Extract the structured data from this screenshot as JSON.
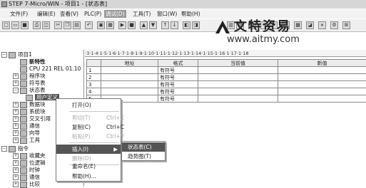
{
  "window": {
    "title": "STEP 7-Micro/WIN - 项目1 - [状态表]"
  },
  "menubar": {
    "items": [
      {
        "label": "文件(F)"
      },
      {
        "label": "编辑(E)"
      },
      {
        "label": "查看(V)"
      },
      {
        "label": "PLC(P)"
      },
      {
        "label": "调试(D)"
      },
      {
        "label": "工具(T)"
      },
      {
        "label": "窗口(W)"
      },
      {
        "label": "帮助(H)"
      }
    ]
  },
  "watermark": {
    "logo_text": "文特资易",
    "url": "www.aitmy.com"
  },
  "tree": {
    "items": [
      {
        "label": "项目1",
        "icon": "project-icon",
        "exp": "-"
      },
      {
        "label": "新特性",
        "icon": "question-icon",
        "exp": ""
      },
      {
        "label": "CPU 221 REL 01.10",
        "icon": "cpu-icon",
        "exp": ""
      },
      {
        "label": "程序块",
        "icon": "folder-icon",
        "exp": "+"
      },
      {
        "label": "符号表",
        "icon": "folder-icon",
        "exp": "+"
      },
      {
        "label": "状态表",
        "icon": "folder-icon",
        "exp": "-"
      },
      {
        "label": "用户定义",
        "icon": "table-icon",
        "exp": ""
      },
      {
        "label": "数据块",
        "icon": "folder-icon",
        "exp": "+"
      },
      {
        "label": "系统块",
        "icon": "folder-icon",
        "exp": "+"
      },
      {
        "label": "交叉引用",
        "icon": "folder-icon",
        "exp": "+"
      },
      {
        "label": "通信",
        "icon": "folder-icon",
        "exp": "+"
      },
      {
        "label": "向导",
        "icon": "folder-icon",
        "exp": "+"
      },
      {
        "label": "工具",
        "icon": "folder-icon",
        "exp": "+"
      },
      {
        "label": "指令",
        "icon": "folder-icon",
        "exp": "-"
      },
      {
        "label": "收藏夹",
        "icon": "folder-icon",
        "exp": "+"
      },
      {
        "label": "位逻辑",
        "icon": "folder-icon",
        "exp": "+"
      },
      {
        "label": "时钟",
        "icon": "folder-icon",
        "exp": "+"
      },
      {
        "label": "通信",
        "icon": "folder-icon",
        "exp": "+"
      },
      {
        "label": "比较",
        "icon": "folder-icon",
        "exp": "+"
      }
    ]
  },
  "ruler": {
    "text": "·3·1·4·1·5·1·6·1·7·1·8·1·9·1·10·1·11·1·12·1·13·1·14·1·15·1·16·1·17·1·18"
  },
  "status_table": {
    "columns": [
      "",
      "地址",
      "格式",
      "当前值",
      "新值"
    ],
    "rows": [
      {
        "n": "1",
        "addr": "",
        "fmt": "有符号",
        "cur": "",
        "new": ""
      },
      {
        "n": "2",
        "addr": "",
        "fmt": "有符号",
        "cur": "",
        "new": ""
      },
      {
        "n": "3",
        "addr": "",
        "fmt": "有符号",
        "cur": "",
        "new": ""
      },
      {
        "n": "4",
        "addr": "",
        "fmt": "有符号",
        "cur": "",
        "new": ""
      },
      {
        "n": "5",
        "addr": "",
        "fmt": "有符号",
        "cur": "",
        "new": ""
      }
    ]
  },
  "context_menu": {
    "items": [
      {
        "label": "打开(O)",
        "key": "",
        "disabled": false
      },
      {
        "label": "剪切(T)",
        "key": "Ctrl+X",
        "disabled": true
      },
      {
        "label": "复制(C)",
        "key": "Ctrl+C",
        "disabled": false
      },
      {
        "label": "粘贴(P)",
        "key": "Ctrl+V",
        "disabled": true
      },
      {
        "label": "插入(I)",
        "key": "",
        "disabled": false,
        "submenu": true
      },
      {
        "label": "删除(D)",
        "key": "",
        "disabled": true
      },
      {
        "label": "重命名(E)",
        "key": "",
        "disabled": false
      },
      {
        "label": "帮助(H)...",
        "key": "",
        "disabled": false
      }
    ]
  },
  "submenu": {
    "items": [
      {
        "label": "状态表(C)"
      },
      {
        "label": "趋势图(T)"
      }
    ]
  }
}
